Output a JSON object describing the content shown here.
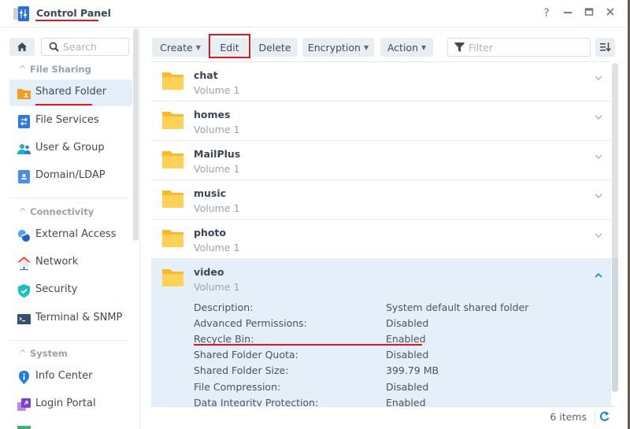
{
  "window": {
    "title": "Control Panel",
    "controls": {
      "help": "?",
      "minimize": "—",
      "maximize": "□",
      "close": "✕"
    }
  },
  "sidebar": {
    "search_placeholder": "Search",
    "groups": [
      {
        "label": "File Sharing",
        "items": [
          {
            "label": "Shared Folder",
            "icon": "shared-folder-icon",
            "active": true
          },
          {
            "label": "File Services",
            "icon": "file-services-icon"
          },
          {
            "label": "User & Group",
            "icon": "user-group-icon"
          },
          {
            "label": "Domain/LDAP",
            "icon": "domain-ldap-icon"
          }
        ]
      },
      {
        "label": "Connectivity",
        "items": [
          {
            "label": "External Access",
            "icon": "external-access-icon"
          },
          {
            "label": "Network",
            "icon": "network-icon"
          },
          {
            "label": "Security",
            "icon": "security-icon"
          },
          {
            "label": "Terminal & SNMP",
            "icon": "terminal-icon"
          }
        ]
      },
      {
        "label": "System",
        "items": [
          {
            "label": "Info Center",
            "icon": "info-icon"
          },
          {
            "label": "Login Portal",
            "icon": "login-portal-icon"
          }
        ]
      }
    ]
  },
  "toolbar": {
    "create": "Create",
    "edit": "Edit",
    "delete": "Delete",
    "encryption": "Encryption",
    "action": "Action",
    "filter_placeholder": "Filter"
  },
  "folders": [
    {
      "name": "chat",
      "volume": "Volume 1"
    },
    {
      "name": "homes",
      "volume": "Volume 1"
    },
    {
      "name": "MailPlus",
      "volume": "Volume 1"
    },
    {
      "name": "music",
      "volume": "Volume 1"
    },
    {
      "name": "photo",
      "volume": "Volume 1"
    },
    {
      "name": "video",
      "volume": "Volume 1",
      "expanded": true,
      "details": [
        {
          "label": "Description:",
          "value": "System default shared folder"
        },
        {
          "label": "Advanced Permissions:",
          "value": "Disabled"
        },
        {
          "label": "Recycle Bin:",
          "value": "Enabled"
        },
        {
          "label": "Shared Folder Quota:",
          "value": "Disabled"
        },
        {
          "label": "Shared Folder Size:",
          "value": "399.79 MB"
        },
        {
          "label": "File Compression:",
          "value": "Disabled"
        },
        {
          "label": "Data Integrity Protection:",
          "value": "Enabled"
        }
      ]
    }
  ],
  "footer": {
    "count": "6 items"
  },
  "colors": {
    "accent": "#1a7fd9",
    "highlight": "#e3161f",
    "folder": "#fbc02d",
    "selected_bg": "#e4effa"
  }
}
